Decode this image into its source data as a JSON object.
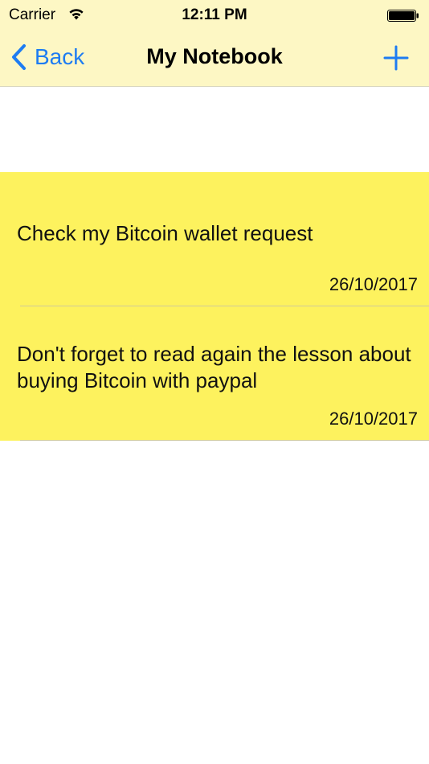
{
  "status_bar": {
    "carrier": "Carrier",
    "time": "12:11 PM",
    "wifi_icon": "wifi-icon",
    "battery_icon": "battery-icon"
  },
  "nav": {
    "back_label": "Back",
    "title": "My Notebook",
    "add_icon": "plus-icon",
    "accent_color": "#1e7cf2",
    "bar_color": "#fdf7c4"
  },
  "notes": [
    {
      "text": "Check my Bitcoin wallet request",
      "date": "26/10/2017"
    },
    {
      "text": "Don't forget to read again the lesson about buying Bitcoin with paypal",
      "date": "26/10/2017"
    }
  ],
  "note_color": "#fdf25e"
}
